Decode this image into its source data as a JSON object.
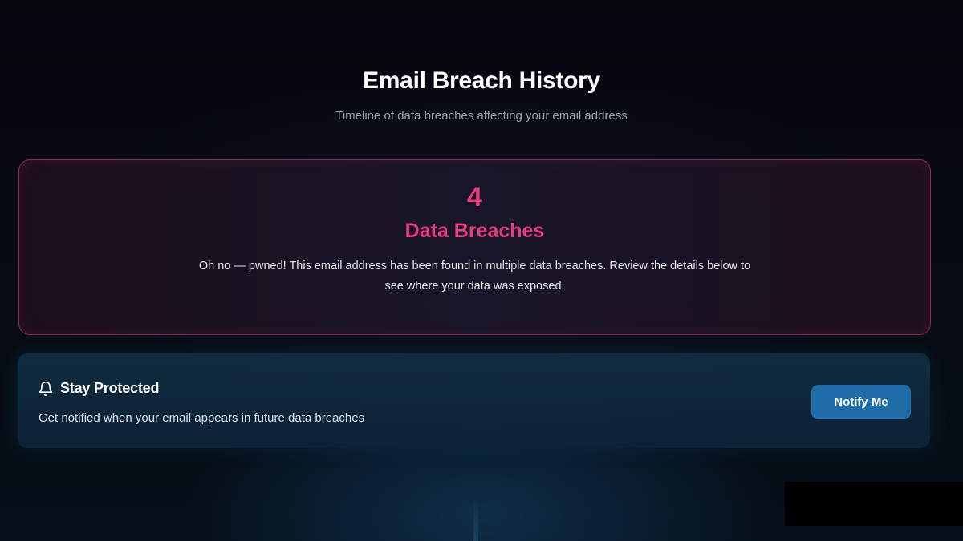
{
  "header": {
    "title": "Email Breach History",
    "subtitle": "Timeline of data breaches affecting your email address"
  },
  "breach_summary": {
    "count": "4",
    "label": "Data Breaches",
    "message": "Oh no — pwned! This email address has been found in multiple data breaches. Review the details below to see where your data was exposed."
  },
  "notify": {
    "icon": "bell-icon",
    "title": "Stay Protected",
    "description": "Get notified when your email appears in future data breaches",
    "button_label": "Notify Me"
  },
  "colors": {
    "accent_pink": "#e43f7e",
    "button_blue": "#1f6da8",
    "card_border": "#8a2a4f"
  }
}
